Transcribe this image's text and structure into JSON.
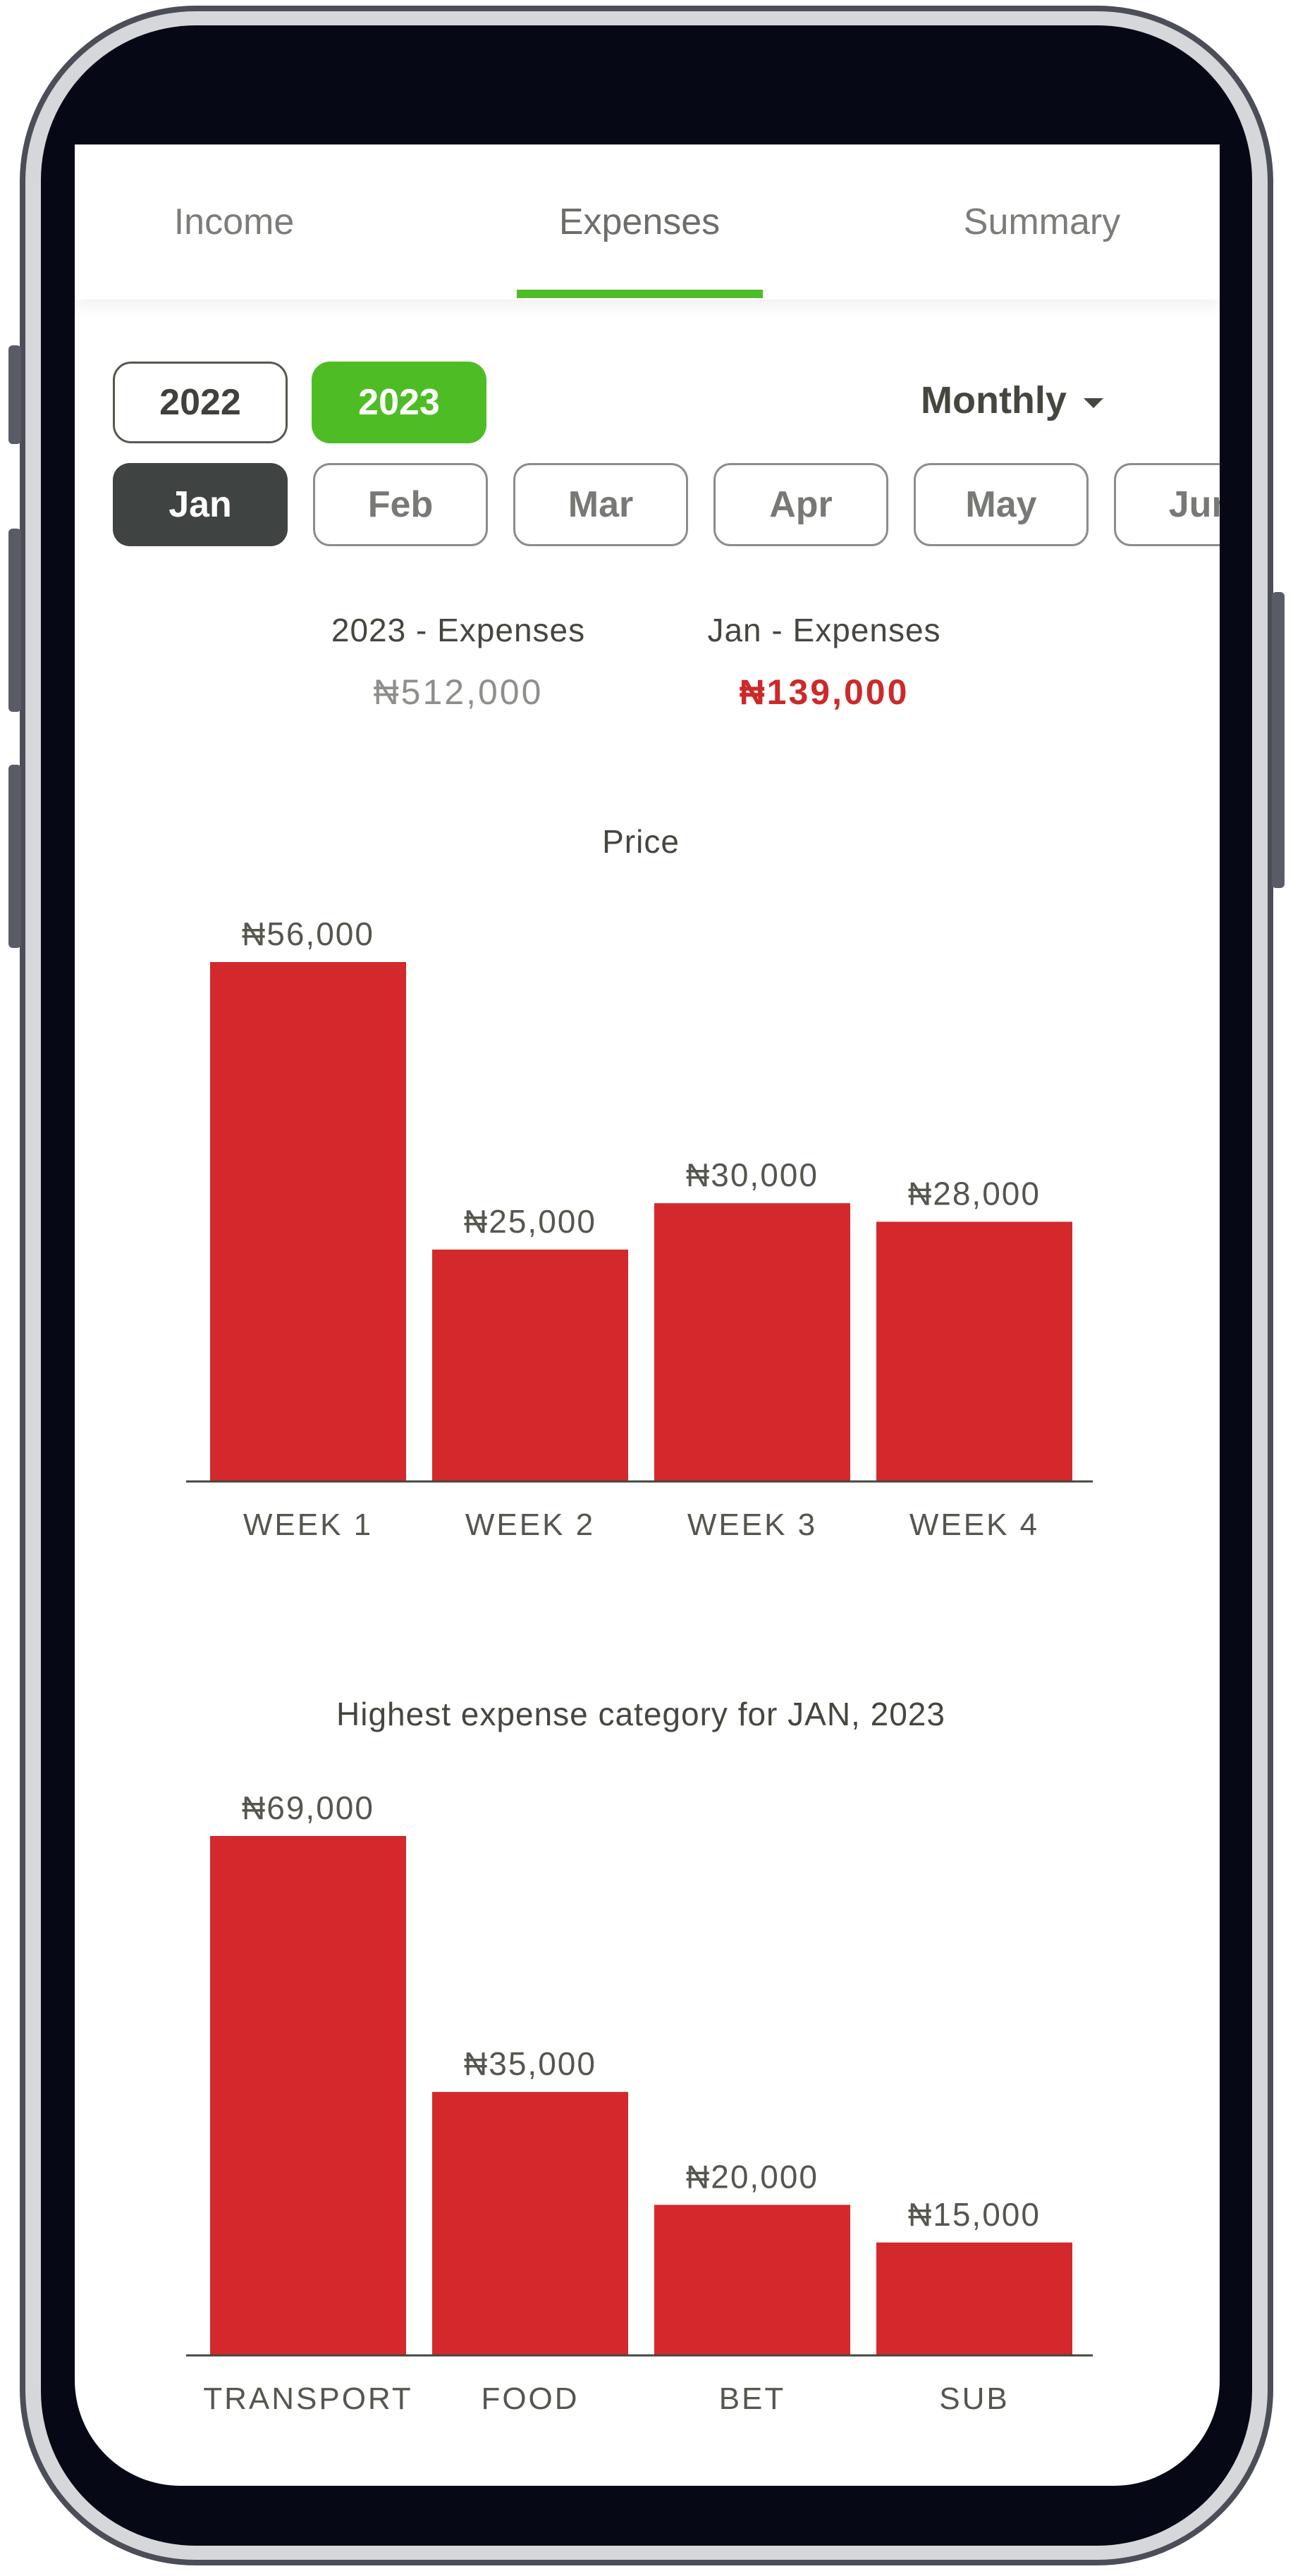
{
  "tabs": [
    {
      "label": "Income"
    },
    {
      "label": "Expenses"
    },
    {
      "label": "Summary"
    }
  ],
  "active_tab": "Expenses",
  "years": [
    "2022",
    "2023"
  ],
  "selected_year": "2023",
  "period": "Monthly",
  "months": [
    "Jan",
    "Feb",
    "Mar",
    "Apr",
    "May",
    "Jun"
  ],
  "selected_month": "Jan",
  "summary": {
    "year_label": "2023 - Expenses",
    "year_value": "₦512,000",
    "month_label": "Jan - Expenses",
    "month_value": "₦139,000"
  },
  "colors": {
    "accent": "#4ebd25",
    "bar": "#d4292c",
    "negative": "#cc2a2a",
    "selected_month": "#3f4341"
  },
  "chart_data": [
    {
      "type": "bar",
      "title": "Price",
      "categories": [
        "WEEK 1",
        "WEEK 2",
        "WEEK 3",
        "WEEK 4"
      ],
      "values": [
        56000,
        25000,
        30000,
        28000
      ],
      "value_labels": [
        "₦56,000",
        "₦25,000",
        "₦30,000",
        "₦28,000"
      ],
      "ylim": [
        0,
        56000
      ]
    },
    {
      "type": "bar",
      "title": "Highest expense category for JAN, 2023",
      "categories": [
        "TRANSPORT",
        "FOOD",
        "BET",
        "SUB"
      ],
      "values": [
        69000,
        35000,
        20000,
        15000
      ],
      "value_labels": [
        "₦69,000",
        "₦35,000",
        "₦20,000",
        "₦15,000"
      ],
      "ylim": [
        0,
        69000
      ]
    }
  ]
}
